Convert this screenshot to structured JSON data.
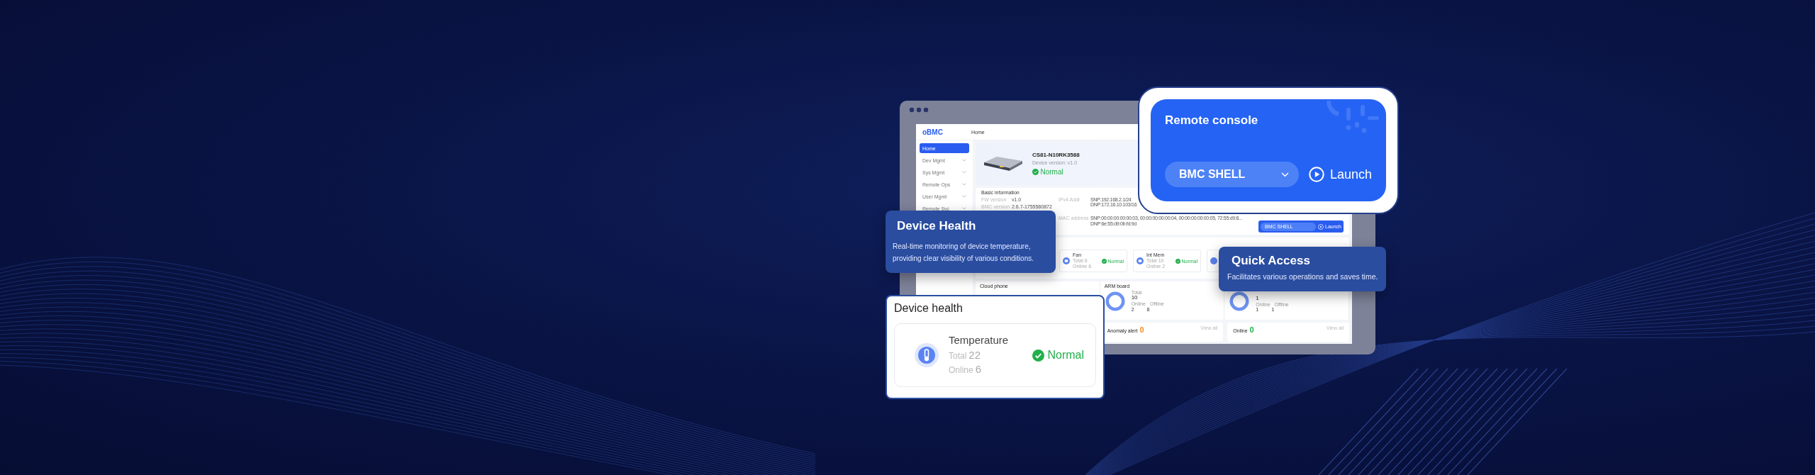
{
  "app": {
    "logo": "oBMC",
    "breadcrumb": "Home",
    "sidebar": [
      {
        "label": "Home",
        "selected": true,
        "expandable": false
      },
      {
        "label": "Dev Mgmt",
        "selected": false,
        "expandable": true
      },
      {
        "label": "Sys Mgmt",
        "selected": false,
        "expandable": true
      },
      {
        "label": "Remote Ops",
        "selected": false,
        "expandable": true
      },
      {
        "label": "User Mgmt",
        "selected": false,
        "expandable": true
      },
      {
        "label": "Remote Svc",
        "selected": false,
        "expandable": true
      }
    ],
    "device": {
      "name": "CS81-N10RK3588",
      "version": "Device version: v1.0",
      "status": "Normal"
    },
    "basic_info": {
      "title": "Basic information",
      "fields": [
        {
          "label": "FW version",
          "value": "v1.0"
        },
        {
          "label": "BMC version",
          "value": "2.6.7-1755580872"
        }
      ],
      "network": [
        {
          "label": "IPv4 Addr",
          "lines": [
            "SNP:192.168.2.1/24",
            "DNP:172.16.10.103/16"
          ]
        },
        {
          "label": "MAC address",
          "lines": [
            "SNP:00:00:00:00:00:03, 00:00:00:00:00:04, 00:00:00:00:00:05, 72:55:d9:8...",
            "DNP:6e:55:d9:0b:fd:9d"
          ]
        }
      ]
    },
    "console_mini": {
      "select": "BMC SHELL",
      "button": "Launch"
    },
    "health_items": [
      {
        "name": "Fan",
        "total": "Total 6",
        "online": "Online 6",
        "status": "Normal"
      },
      {
        "name": "Int Mem",
        "total": "Total 10",
        "online": "Online 2",
        "status": "Normal"
      }
    ],
    "stats": [
      {
        "title": "Cloud phone"
      },
      {
        "title": "ARM board",
        "total_label": "Total",
        "total": "10",
        "online_label": "Online",
        "offline_label": "Offline",
        "online": "2",
        "offline": "8"
      },
      {
        "total": "1",
        "online_label": "Online",
        "offline_label": "Offline",
        "online": "1",
        "offline": "1"
      }
    ],
    "alerts": [
      {
        "label": "Anomaly alert",
        "count": "0",
        "color": "#f5902a",
        "link": "View all"
      },
      {
        "label": "Online",
        "count": "0",
        "color": "#22b04b",
        "link": "View all"
      }
    ]
  },
  "remote_console": {
    "title": "Remote console",
    "select": "BMC SHELL",
    "button": "Launch"
  },
  "device_health_tip": {
    "title": "Device Health",
    "description": "Real-time monitoring of device temperature, providing clear visibility of various conditions."
  },
  "device_health_card": {
    "title": "Device health",
    "item": {
      "name": "Temperature",
      "total_label": "Total",
      "total": "22",
      "online_label": "Online",
      "online": "6",
      "status": "Normal"
    }
  },
  "quick_access": {
    "title": "Quick Access",
    "description": "Facilitates various operations and saves time."
  }
}
